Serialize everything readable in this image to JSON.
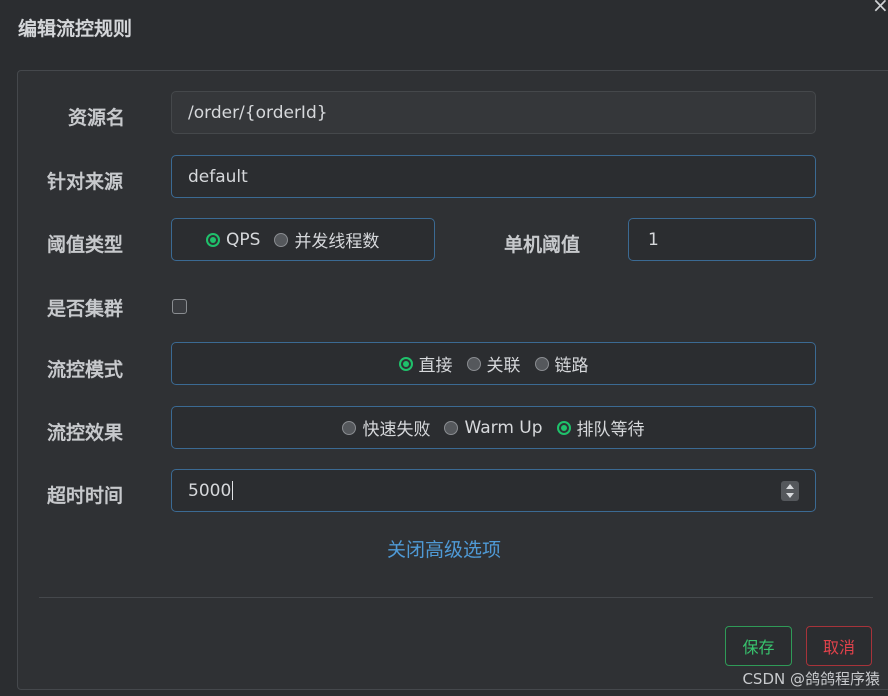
{
  "dialog": {
    "title": "编辑流控规则",
    "close_symbol": "×"
  },
  "form": {
    "resource": {
      "label": "资源名",
      "value": "/order/{orderId}"
    },
    "origin": {
      "label": "针对来源",
      "value": "default"
    },
    "threshold_type": {
      "label": "阈值类型",
      "options": [
        "QPS",
        "并发线程数"
      ],
      "selected": "QPS"
    },
    "single_threshold": {
      "label": "单机阈值",
      "value": "1"
    },
    "cluster": {
      "label": "是否集群",
      "checked": false
    },
    "flow_mode": {
      "label": "流控模式",
      "options": [
        "直接",
        "关联",
        "链路"
      ],
      "selected": "直接"
    },
    "flow_effect": {
      "label": "流控效果",
      "options": [
        "快速失败",
        "Warm Up",
        "排队等待"
      ],
      "selected": "排队等待"
    },
    "timeout": {
      "label": "超时时间",
      "value": "5000"
    }
  },
  "advanced_toggle": "关闭高级选项",
  "buttons": {
    "save": "保存",
    "cancel": "取消"
  },
  "watermark": "CSDN @鸽鸽程序猿",
  "colors": {
    "accent_green": "#1fc16b",
    "link_blue": "#4f9ad6",
    "cancel_red": "#e0424b"
  }
}
